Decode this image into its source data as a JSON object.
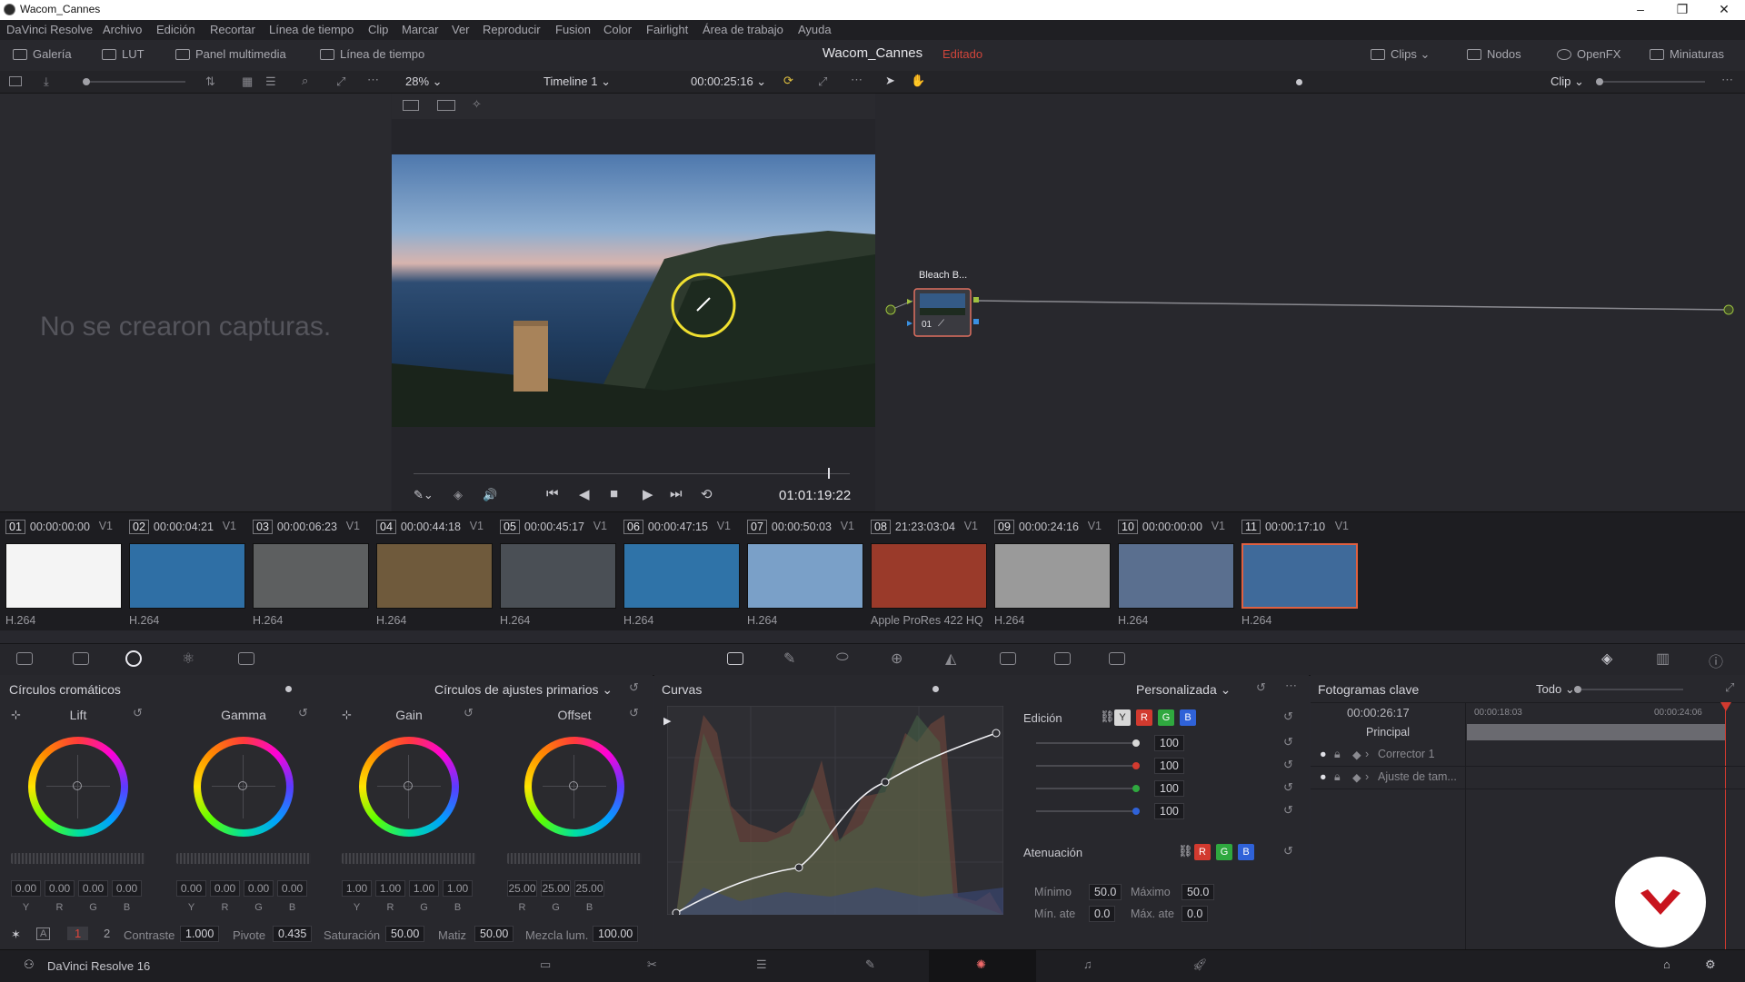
{
  "window": {
    "title": "Wacom_Cannes",
    "minimize": "–",
    "maximize": "❐",
    "close": "✕"
  },
  "menu": [
    "DaVinci Resolve",
    "Archivo",
    "Edición",
    "Recortar",
    "Línea de tiempo",
    "Clip",
    "Marcar",
    "Ver",
    "Reproducir",
    "Fusion",
    "Color",
    "Fairlight",
    "Área de trabajo",
    "Ayuda"
  ],
  "toolbar": {
    "gallery": "Galería",
    "lut": "LUT",
    "media_panel": "Panel multimedia",
    "timeline": "Línea de tiempo",
    "project": "Wacom_Cannes",
    "status": "Editado",
    "clips": "Clips",
    "nodes": "Nodos",
    "openfx": "OpenFX",
    "thumbnails": "Miniaturas"
  },
  "subbar": {
    "zoom": "28%",
    "timeline_name": "Timeline 1",
    "timecode": "00:00:25:16",
    "node_mode": "Clip"
  },
  "gallery": {
    "empty_message": "No se crearon capturas."
  },
  "viewer": {
    "timecode": "01:01:19:22",
    "scrub_position": 0.95
  },
  "node": {
    "label": "Bleach B...",
    "id": "01"
  },
  "clips": [
    {
      "num": "01",
      "tc": "00:00:00:00",
      "track": "V1",
      "codec": "H.264",
      "thumb": "#f4f4f4"
    },
    {
      "num": "02",
      "tc": "00:00:04:21",
      "track": "V1",
      "codec": "H.264",
      "thumb": "#2f6fa5"
    },
    {
      "num": "03",
      "tc": "00:00:06:23",
      "track": "V1",
      "codec": "H.264",
      "thumb": "#5d5f60"
    },
    {
      "num": "04",
      "tc": "00:00:44:18",
      "track": "V1",
      "codec": "H.264",
      "thumb": "#6f5a3c"
    },
    {
      "num": "05",
      "tc": "00:00:45:17",
      "track": "V1",
      "codec": "H.264",
      "thumb": "#4a4f55"
    },
    {
      "num": "06",
      "tc": "00:00:47:15",
      "track": "V1",
      "codec": "H.264",
      "thumb": "#2f73a8"
    },
    {
      "num": "07",
      "tc": "00:00:50:03",
      "track": "V1",
      "codec": "H.264",
      "thumb": "#7aa0c8"
    },
    {
      "num": "08",
      "tc": "21:23:03:04",
      "track": "V1",
      "codec": "Apple ProRes 422 HQ",
      "thumb": "#9a3a2a"
    },
    {
      "num": "09",
      "tc": "00:00:24:16",
      "track": "V1",
      "codec": "H.264",
      "thumb": "#9a9a9a"
    },
    {
      "num": "10",
      "tc": "00:00:00:00",
      "track": "V1",
      "codec": "H.264",
      "thumb": "#5a6f8f"
    },
    {
      "num": "11",
      "tc": "00:00:17:10",
      "track": "V1",
      "codec": "H.264",
      "thumb": "#3f6a9a"
    }
  ],
  "color_wheels": {
    "title": "Círculos cromáticos",
    "mode": "Círculos de ajustes primarios",
    "wheels": [
      {
        "name": "Lift",
        "values": [
          "0.00",
          "0.00",
          "0.00",
          "0.00"
        ],
        "labels": [
          "Y",
          "R",
          "G",
          "B"
        ]
      },
      {
        "name": "Gamma",
        "values": [
          "0.00",
          "0.00",
          "0.00",
          "0.00"
        ],
        "labels": [
          "Y",
          "R",
          "G",
          "B"
        ]
      },
      {
        "name": "Gain",
        "values": [
          "1.00",
          "1.00",
          "1.00",
          "1.00"
        ],
        "labels": [
          "Y",
          "R",
          "G",
          "B"
        ]
      },
      {
        "name": "Offset",
        "values": [
          "25.00",
          "25.00",
          "25.00"
        ],
        "labels": [
          "R",
          "G",
          "B"
        ]
      }
    ]
  },
  "adjustments": {
    "page1": "1",
    "page2": "2",
    "contrast_label": "Contraste",
    "contrast": "1.000",
    "pivot_label": "Pivote",
    "pivot": "0.435",
    "saturation_label": "Saturación",
    "saturation": "50.00",
    "hue_label": "Matiz",
    "hue": "50.00",
    "lum_mix_label": "Mezcla lum.",
    "lum_mix": "100.00"
  },
  "curves": {
    "title": "Curvas",
    "mode": "Personalizada",
    "edit_label": "Edición",
    "channels": [
      "Y",
      "R",
      "G",
      "B"
    ],
    "channel_colors": [
      "#d7d7d7",
      "#d23a2f",
      "#2fa83f",
      "#2f62d8"
    ],
    "intensity": [
      "100",
      "100",
      "100",
      "100"
    ],
    "soft_clip_label": "Atenuación",
    "min_label": "Mínimo",
    "min": "50.0",
    "max_label": "Máximo",
    "max": "50.0",
    "min_att_label": "Mín. ate",
    "min_att": "0.0",
    "max_att_label": "Máx. ate",
    "max_att": "0.0"
  },
  "keyframes": {
    "title": "Fotogramas clave",
    "filter": "Todo",
    "timecode": "00:00:26:17",
    "ruler_start": "00:00:18:03",
    "ruler_end": "00:00:24:06",
    "rows": [
      "Principal",
      "Corrector 1",
      "Ajuste de tam..."
    ]
  },
  "footer": {
    "app": "DaVinci Resolve 16"
  }
}
